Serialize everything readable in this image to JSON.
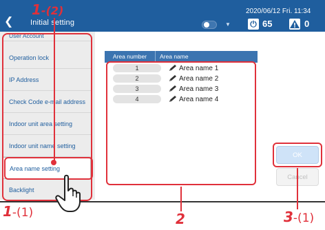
{
  "header": {
    "title": "Initial setting",
    "datetime": "2020/06/12 Fri. 11:34",
    "power_count": "65",
    "warning_count": "0"
  },
  "sidebar": {
    "items": [
      {
        "label": "User Account"
      },
      {
        "label": "Operation lock"
      },
      {
        "label": "IP Address"
      },
      {
        "label": "Check Code e-mail address"
      },
      {
        "label": "Indoor unit area setting"
      },
      {
        "label": "Indoor unit name setting"
      },
      {
        "label": "Area name setting",
        "selected": true
      },
      {
        "label": "Backlight"
      }
    ]
  },
  "table": {
    "col_number": "Area number",
    "col_name": "Area name",
    "rows": [
      {
        "number": "1",
        "name": "Area name 1"
      },
      {
        "number": "2",
        "name": "Area name 2"
      },
      {
        "number": "3",
        "name": "Area name 3"
      },
      {
        "number": "4",
        "name": "Area name 4"
      }
    ]
  },
  "buttons": {
    "ok": "OK",
    "cancel": "Cancel"
  },
  "annotations": {
    "step1_2_main": "1",
    "step1_2_sub": "-(2)",
    "step1_1_main": "1",
    "step1_1_sub": "-(1)",
    "step2": "2",
    "step3_main": "3",
    "step3_sub": "-(1)"
  },
  "colors": {
    "header": "#1f5e9e",
    "annotation": "#e0303a",
    "table_header": "#3b74b0"
  }
}
